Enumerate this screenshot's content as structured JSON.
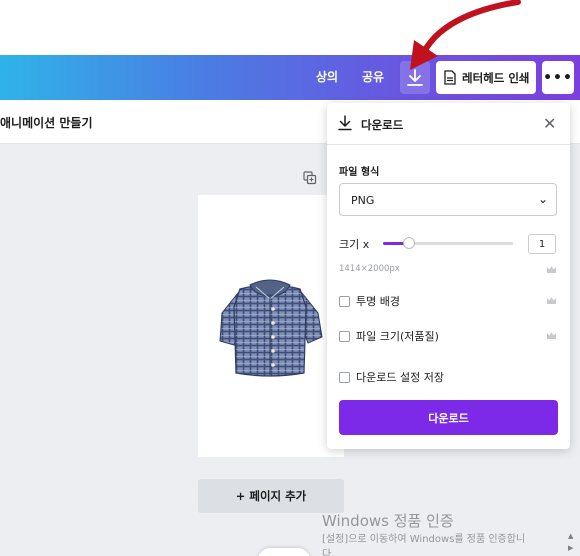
{
  "toolbar": {
    "top_label": "상의",
    "share_label": "공유",
    "download_icon": "download-icon",
    "print_label": "레터헤드 인쇄",
    "print_icon": "document-icon",
    "more_label": "•••"
  },
  "title_row": {
    "label": "애니메이션 만들기"
  },
  "canvas": {
    "duplicate_icon": "copy-page-icon",
    "design_image": "blue-plaid-shirt-illustration",
    "add_page_label": "+ 페이지 추가"
  },
  "download_panel": {
    "title": "다운로드",
    "close_icon": "close-icon",
    "file_type_label": "파일 형식",
    "file_type_value": "PNG",
    "size_label": "크기 x",
    "size_value": "1",
    "slider_fraction": 0.2,
    "dimensions_text": "1414×2000px",
    "options": [
      {
        "label": "투명 배경",
        "premium": true
      },
      {
        "label": "파일 크기(저품질)",
        "premium": true
      },
      {
        "label": "다운로드 설정 저장",
        "premium": false
      }
    ],
    "button_label": "다운로드",
    "accent_color": "#7d2ae8"
  },
  "watermark": {
    "title": "Windows 정품 인증",
    "line1": "[설정]으로 이동하여 Windows를 정품 인증합니",
    "line2": "다."
  },
  "colors": {
    "gradient_start": "#2fb3e8",
    "gradient_end": "#7b3fe0",
    "annotation_arrow": "#c0111f"
  }
}
